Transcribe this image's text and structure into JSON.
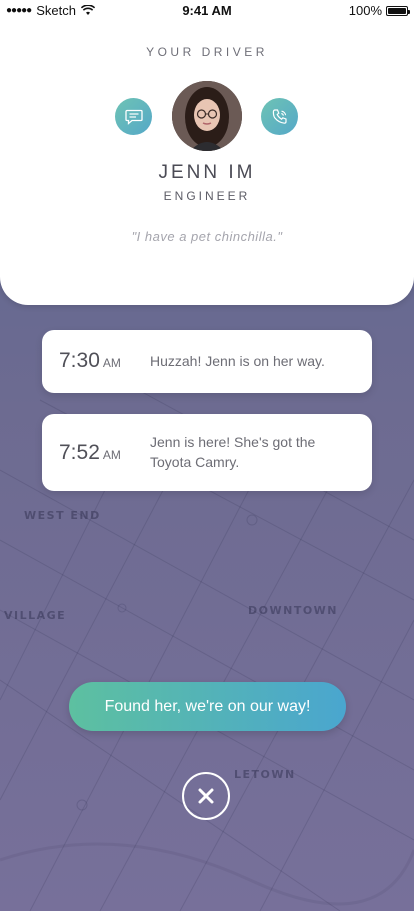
{
  "status_bar": {
    "signal_dots": "●●●●●",
    "carrier": "Sketch",
    "time": "9:41 AM",
    "battery": "100%"
  },
  "driver": {
    "heading": "YOUR DRIVER",
    "name": "JENN IM",
    "role": "ENGINEER",
    "quote": "\"I have a pet chinchilla.\""
  },
  "events": [
    {
      "time": "7:30",
      "ampm": "AM",
      "text": "Huzzah! Jenn is on her way."
    },
    {
      "time": "7:52",
      "ampm": "AM",
      "text": "Jenn is here! She's got the Toyota Camry."
    }
  ],
  "map": {
    "labels": [
      "WEST END",
      "VILLAGE",
      "DOWNTOWN",
      "LETOWN"
    ]
  },
  "actions": {
    "confirm_label": "Found her, we're on our way!",
    "close_glyph": "✕"
  },
  "colors": {
    "accent_start": "#5dc0a0",
    "accent_end": "#4aa6cf",
    "map_top": "#5b6790",
    "map_bottom": "#77709a"
  },
  "icons": {
    "message": "chat-bubble-icon",
    "call": "phone-icon",
    "close": "close-icon",
    "wifi": "wifi-icon",
    "battery": "battery-icon"
  }
}
